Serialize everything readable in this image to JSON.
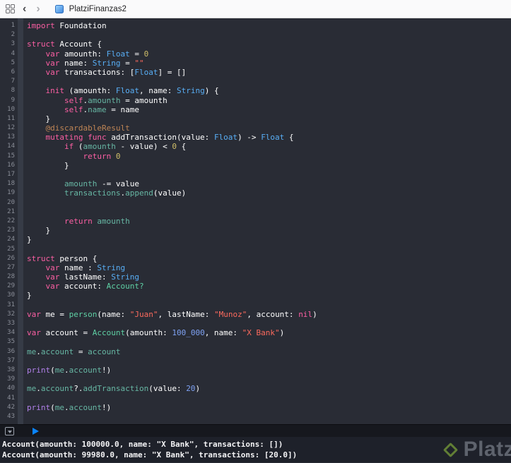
{
  "titlebar": {
    "title": "PlatziFinanzas2",
    "back_label": "‹",
    "forward_label": "›"
  },
  "editor": {
    "background": "#292C35",
    "colors": {
      "p": "#FFFFFF",
      "k": "#FC5FA3",
      "s": "#FC6A5D",
      "n": "#D0BF69",
      "nb": "#7FA3F5",
      "t": "#58AEF5",
      "pt": "#5FD1A5",
      "pr": "#67B7A4",
      "sf": "#B281EB",
      "at": "#BF8555"
    },
    "lines": [
      [
        [
          "k",
          "import"
        ],
        [
          "p",
          " Foundation"
        ]
      ],
      [],
      [
        [
          "k",
          "struct"
        ],
        [
          "p",
          " Account {"
        ]
      ],
      [
        [
          "p",
          "    "
        ],
        [
          "k",
          "var"
        ],
        [
          "p",
          " amounth: "
        ],
        [
          "t",
          "Float"
        ],
        [
          "p",
          " = "
        ],
        [
          "n",
          "0"
        ]
      ],
      [
        [
          "p",
          "    "
        ],
        [
          "k",
          "var"
        ],
        [
          "p",
          " name: "
        ],
        [
          "t",
          "String"
        ],
        [
          "p",
          " = "
        ],
        [
          "s",
          "\"\""
        ]
      ],
      [
        [
          "p",
          "    "
        ],
        [
          "k",
          "var"
        ],
        [
          "p",
          " transactions: ["
        ],
        [
          "t",
          "Float"
        ],
        [
          "p",
          "] = []"
        ]
      ],
      [],
      [
        [
          "p",
          "    "
        ],
        [
          "k",
          "init"
        ],
        [
          "p",
          " (amounth: "
        ],
        [
          "t",
          "Float"
        ],
        [
          "p",
          ", name: "
        ],
        [
          "t",
          "String"
        ],
        [
          "p",
          ") {"
        ]
      ],
      [
        [
          "p",
          "        "
        ],
        [
          "k",
          "self"
        ],
        [
          "p",
          "."
        ],
        [
          "pr",
          "amounth"
        ],
        [
          "p",
          " = amounth"
        ]
      ],
      [
        [
          "p",
          "        "
        ],
        [
          "k",
          "self"
        ],
        [
          "p",
          "."
        ],
        [
          "pr",
          "name"
        ],
        [
          "p",
          " = name"
        ]
      ],
      [
        [
          "p",
          "    }"
        ]
      ],
      [
        [
          "p",
          "    "
        ],
        [
          "at",
          "@discardableResult"
        ]
      ],
      [
        [
          "p",
          "    "
        ],
        [
          "k",
          "mutating"
        ],
        [
          "p",
          " "
        ],
        [
          "k",
          "func"
        ],
        [
          "p",
          " addTransaction(value: "
        ],
        [
          "t",
          "Float"
        ],
        [
          "p",
          ") -> "
        ],
        [
          "t",
          "Float"
        ],
        [
          "p",
          " {"
        ]
      ],
      [
        [
          "p",
          "        "
        ],
        [
          "k",
          "if"
        ],
        [
          "p",
          " ("
        ],
        [
          "pr",
          "amounth"
        ],
        [
          "p",
          " - value) < "
        ],
        [
          "n",
          "0"
        ],
        [
          "p",
          " {"
        ]
      ],
      [
        [
          "p",
          "            "
        ],
        [
          "k",
          "return"
        ],
        [
          "p",
          " "
        ],
        [
          "n",
          "0"
        ]
      ],
      [
        [
          "p",
          "        }"
        ]
      ],
      [],
      [
        [
          "p",
          "        "
        ],
        [
          "pr",
          "amounth"
        ],
        [
          "p",
          " -= value"
        ]
      ],
      [
        [
          "p",
          "        "
        ],
        [
          "pr",
          "transactions"
        ],
        [
          "p",
          "."
        ],
        [
          "pr",
          "append"
        ],
        [
          "p",
          "(value)"
        ]
      ],
      [],
      [],
      [
        [
          "p",
          "        "
        ],
        [
          "k",
          "return"
        ],
        [
          "p",
          " "
        ],
        [
          "pr",
          "amounth"
        ]
      ],
      [
        [
          "p",
          "    }"
        ]
      ],
      [
        [
          "p",
          "}"
        ]
      ],
      [],
      [
        [
          "k",
          "struct"
        ],
        [
          "p",
          " person {"
        ]
      ],
      [
        [
          "p",
          "    "
        ],
        [
          "k",
          "var"
        ],
        [
          "p",
          " name : "
        ],
        [
          "t",
          "String"
        ]
      ],
      [
        [
          "p",
          "    "
        ],
        [
          "k",
          "var"
        ],
        [
          "p",
          " lastName: "
        ],
        [
          "t",
          "String"
        ]
      ],
      [
        [
          "p",
          "    "
        ],
        [
          "k",
          "var"
        ],
        [
          "p",
          " account: "
        ],
        [
          "pt",
          "Account?"
        ]
      ],
      [
        [
          "p",
          "}"
        ]
      ],
      [],
      [
        [
          "k",
          "var"
        ],
        [
          "p",
          " me = "
        ],
        [
          "pt",
          "person"
        ],
        [
          "p",
          "(name: "
        ],
        [
          "s",
          "\"Juan\""
        ],
        [
          "p",
          ", lastName: "
        ],
        [
          "s",
          "\"Munoz\""
        ],
        [
          "p",
          ", account: "
        ],
        [
          "k",
          "nil"
        ],
        [
          "p",
          ")"
        ]
      ],
      [],
      [
        [
          "k",
          "var"
        ],
        [
          "p",
          " account = "
        ],
        [
          "pt",
          "Account"
        ],
        [
          "p",
          "(amounth: "
        ],
        [
          "nb",
          "100_000"
        ],
        [
          "p",
          ", name: "
        ],
        [
          "s",
          "\"X Bank\""
        ],
        [
          "p",
          ")"
        ]
      ],
      [],
      [
        [
          "pr",
          "me"
        ],
        [
          "p",
          "."
        ],
        [
          "pr",
          "account"
        ],
        [
          "p",
          " = "
        ],
        [
          "pr",
          "account"
        ]
      ],
      [],
      [
        [
          "sf",
          "print"
        ],
        [
          "p",
          "("
        ],
        [
          "pr",
          "me"
        ],
        [
          "p",
          "."
        ],
        [
          "pr",
          "account"
        ],
        [
          "p",
          "!)"
        ]
      ],
      [],
      [
        [
          "pr",
          "me"
        ],
        [
          "p",
          "."
        ],
        [
          "pr",
          "account"
        ],
        [
          "p",
          "?."
        ],
        [
          "pr",
          "addTransaction"
        ],
        [
          "p",
          "(value: "
        ],
        [
          "nb",
          "20"
        ],
        [
          "p",
          ")"
        ]
      ],
      [],
      [
        [
          "sf",
          "print"
        ],
        [
          "p",
          "("
        ],
        [
          "pr",
          "me"
        ],
        [
          "p",
          "."
        ],
        [
          "pr",
          "account"
        ],
        [
          "p",
          "!)"
        ]
      ],
      []
    ]
  },
  "debug_bar": {
    "play_color": "#0A84FF"
  },
  "console": {
    "lines": [
      "Account(amounth: 100000.0, name: \"X Bank\", transactions: [])",
      "Account(amounth: 99980.0, name: \"X Bank\", transactions: [20.0])"
    ]
  },
  "watermark": {
    "text": "Platzi",
    "logo_color": "#98CA3F"
  }
}
